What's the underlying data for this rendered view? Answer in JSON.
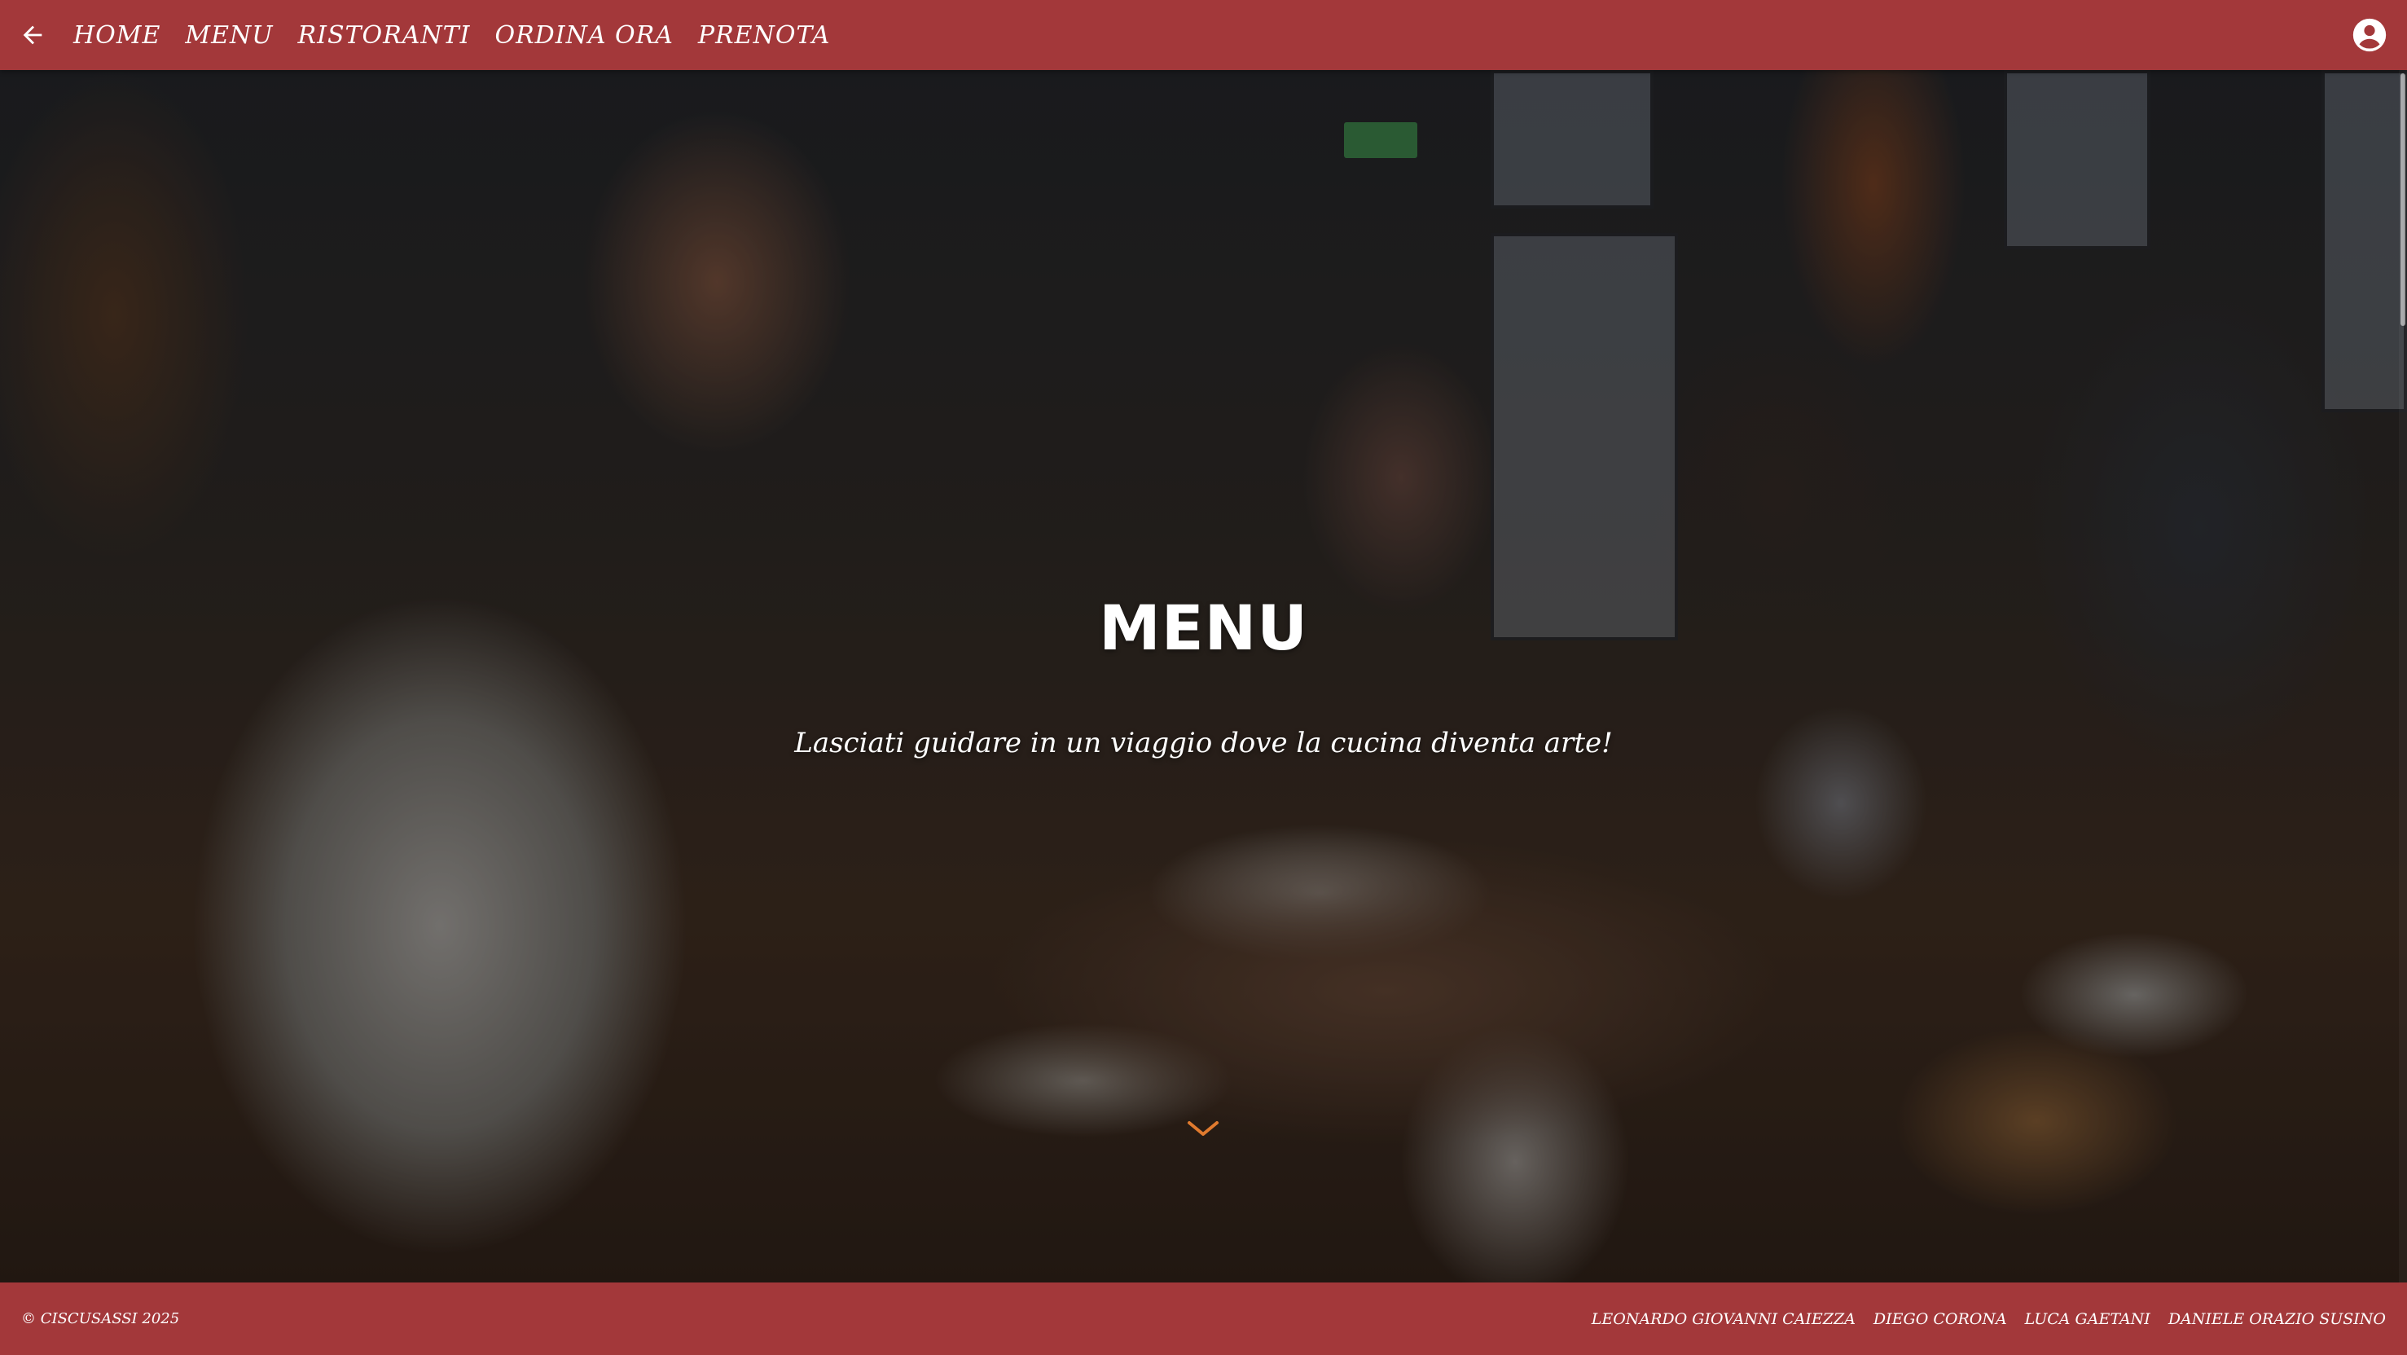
{
  "header": {
    "back_icon": "arrow-left-icon",
    "nav": [
      {
        "label": "HOME"
      },
      {
        "label": "MENU"
      },
      {
        "label": "RISTORANTI"
      },
      {
        "label": "ORDINA ORA"
      },
      {
        "label": "PRENOTA"
      }
    ],
    "account_icon": "account-circle-icon"
  },
  "hero": {
    "title": "MENU",
    "subtitle": "Lasciati guidare in un viaggio dove la cucina diventa arte!",
    "scroll_icon": "chevron-down-icon"
  },
  "footer": {
    "copyright": "© CISCUSASSI 2025",
    "authors": [
      {
        "name": "LEONARDO GIOVANNI CAIEZZA"
      },
      {
        "name": "DIEGO CORONA"
      },
      {
        "name": "LUCA GAETANI"
      },
      {
        "name": "DANIELE ORAZIO SUSINO"
      }
    ]
  },
  "colors": {
    "brand_red": "#a3383a",
    "text": "#ffffff",
    "accent_orange": "#e07a2e"
  }
}
